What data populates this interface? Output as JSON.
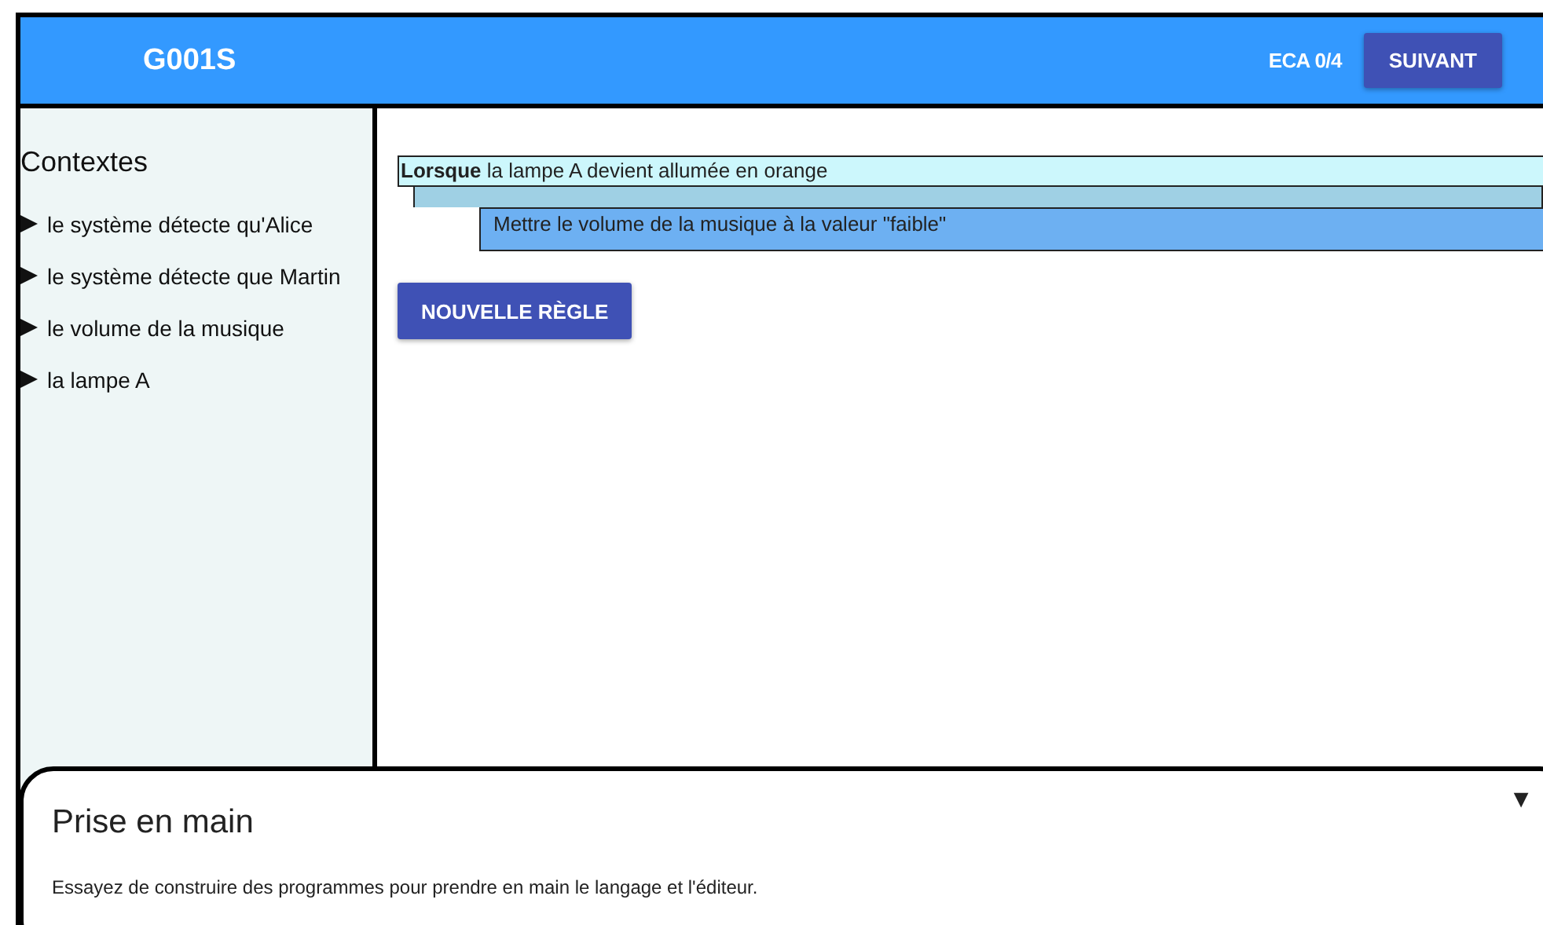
{
  "header": {
    "title": "G001S",
    "progress": "ECA 0/4",
    "next_button": "SUIVANT"
  },
  "sidebar": {
    "title": "Contextes",
    "items": [
      {
        "label": "le système détecte qu'Alice",
        "expanded": false
      },
      {
        "label": "le système détecte que Martin",
        "expanded": false
      },
      {
        "label": "le volume de la musique",
        "expanded": false
      },
      {
        "label": "la lampe A",
        "expanded": false
      }
    ]
  },
  "rules": [
    {
      "condition": "**Lorsque** la lampe A devient allumée en orange",
      "action": "Mettre le volume de la musique à la valeur \"faible\""
    }
  ],
  "new_rule_button": "NOUVELLE RÈGLE",
  "help_panel": {
    "title": "Prise en main",
    "toggle": "▼",
    "text": "Essayez de construire des programmes pour prendre en main le langage et l'éditeur."
  }
}
